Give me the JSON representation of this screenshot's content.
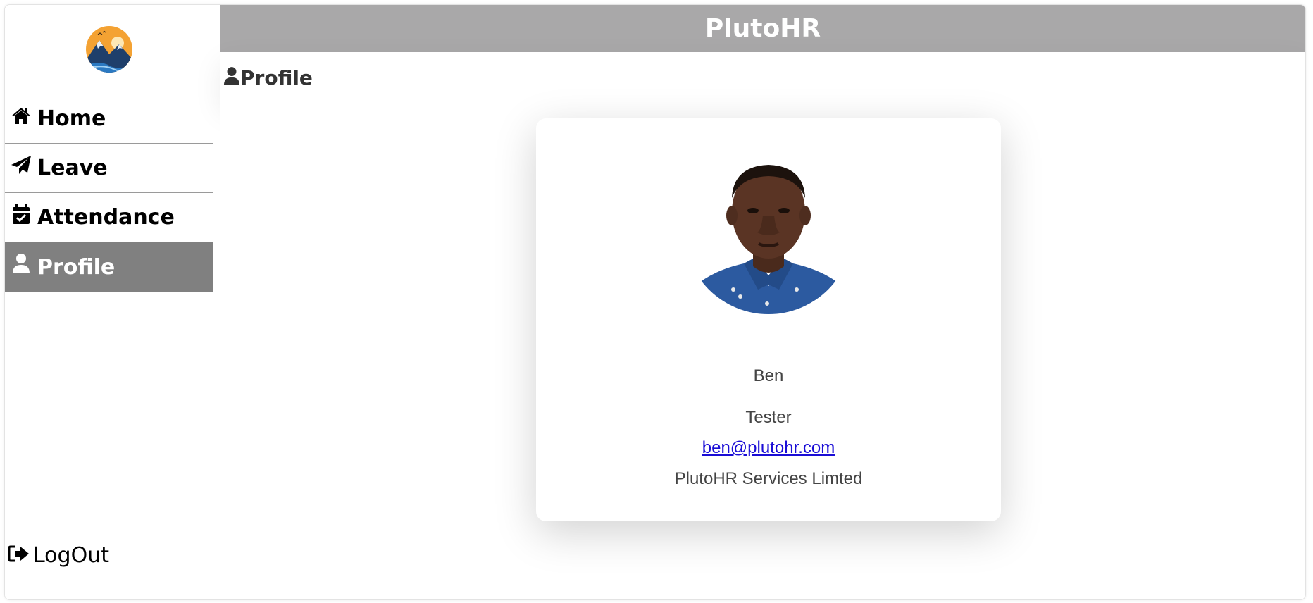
{
  "app": {
    "title": "PlutoHR"
  },
  "sidebar": {
    "logo": "mountain-sun-logo",
    "items": [
      {
        "label": "Home",
        "icon": "home-icon",
        "active": false
      },
      {
        "label": "Leave",
        "icon": "paper-plane-icon",
        "active": false
      },
      {
        "label": "Attendance",
        "icon": "calendar-check-icon",
        "active": false
      },
      {
        "label": "Profile",
        "icon": "user-icon",
        "active": true
      }
    ],
    "logout": {
      "label": "LogOut",
      "icon": "sign-out-icon"
    }
  },
  "page": {
    "heading": "Profile",
    "heading_icon": "user-icon"
  },
  "profile": {
    "name": "Ben",
    "role": "Tester",
    "email": "ben@plutohr.com",
    "company": "PlutoHR Services Limted"
  },
  "colors": {
    "topbar": "#a9a8a9",
    "active_nav": "#808080",
    "link": "#1a0dd6"
  }
}
